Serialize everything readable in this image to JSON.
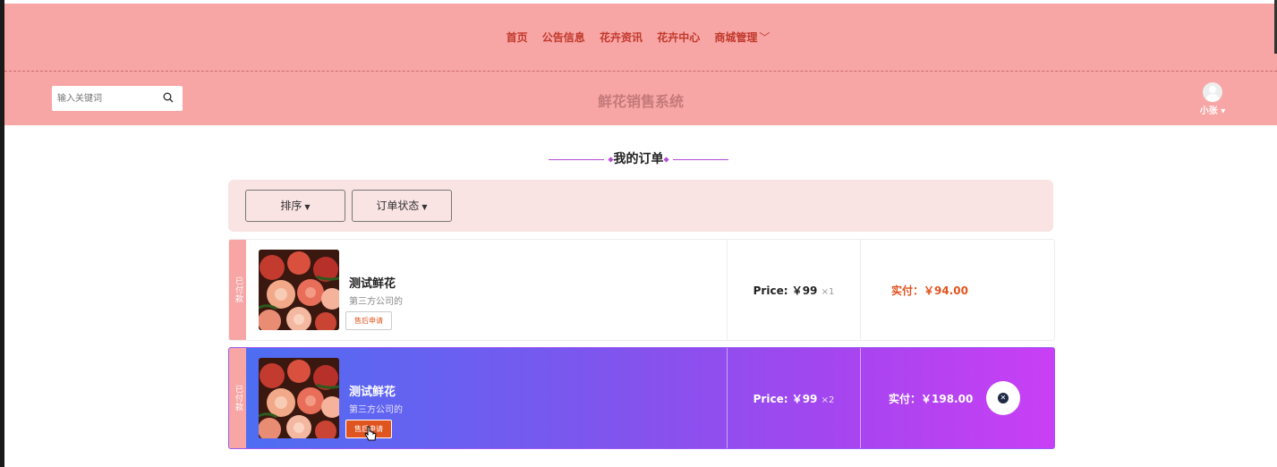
{
  "nav": {
    "items": [
      "首页",
      "公告信息",
      "花卉资讯",
      "花卉中心",
      "商城管理"
    ],
    "dropdown_icon": "chevron-down-icon"
  },
  "header": {
    "search_placeholder": "输入关键词",
    "site_title": "鲜花销售系统",
    "user_name": "小张",
    "user_caret": "▾"
  },
  "section": {
    "title": "我的订单"
  },
  "filters": {
    "sort_label": "排序",
    "status_label": "订单状态"
  },
  "orders": [
    {
      "status": "已付款",
      "name": "测试鲜花",
      "seller": "第三方公司的",
      "after_sale": "售后申请",
      "price": "Price: ￥99",
      "qty": "×1",
      "paid": "实付：￥94.00"
    },
    {
      "status": "已付款",
      "name": "测试鲜花",
      "seller": "第三方公司的",
      "after_sale": "售后申请",
      "price": "Price: ￥99",
      "qty": "×2",
      "paid": "实付：￥198.00"
    }
  ],
  "colors": {
    "header_bg": "#f8a5a5",
    "accent_orange": "#e0541f",
    "gradient_start": "#4b6ff2",
    "gradient_end": "#c93ff4"
  }
}
